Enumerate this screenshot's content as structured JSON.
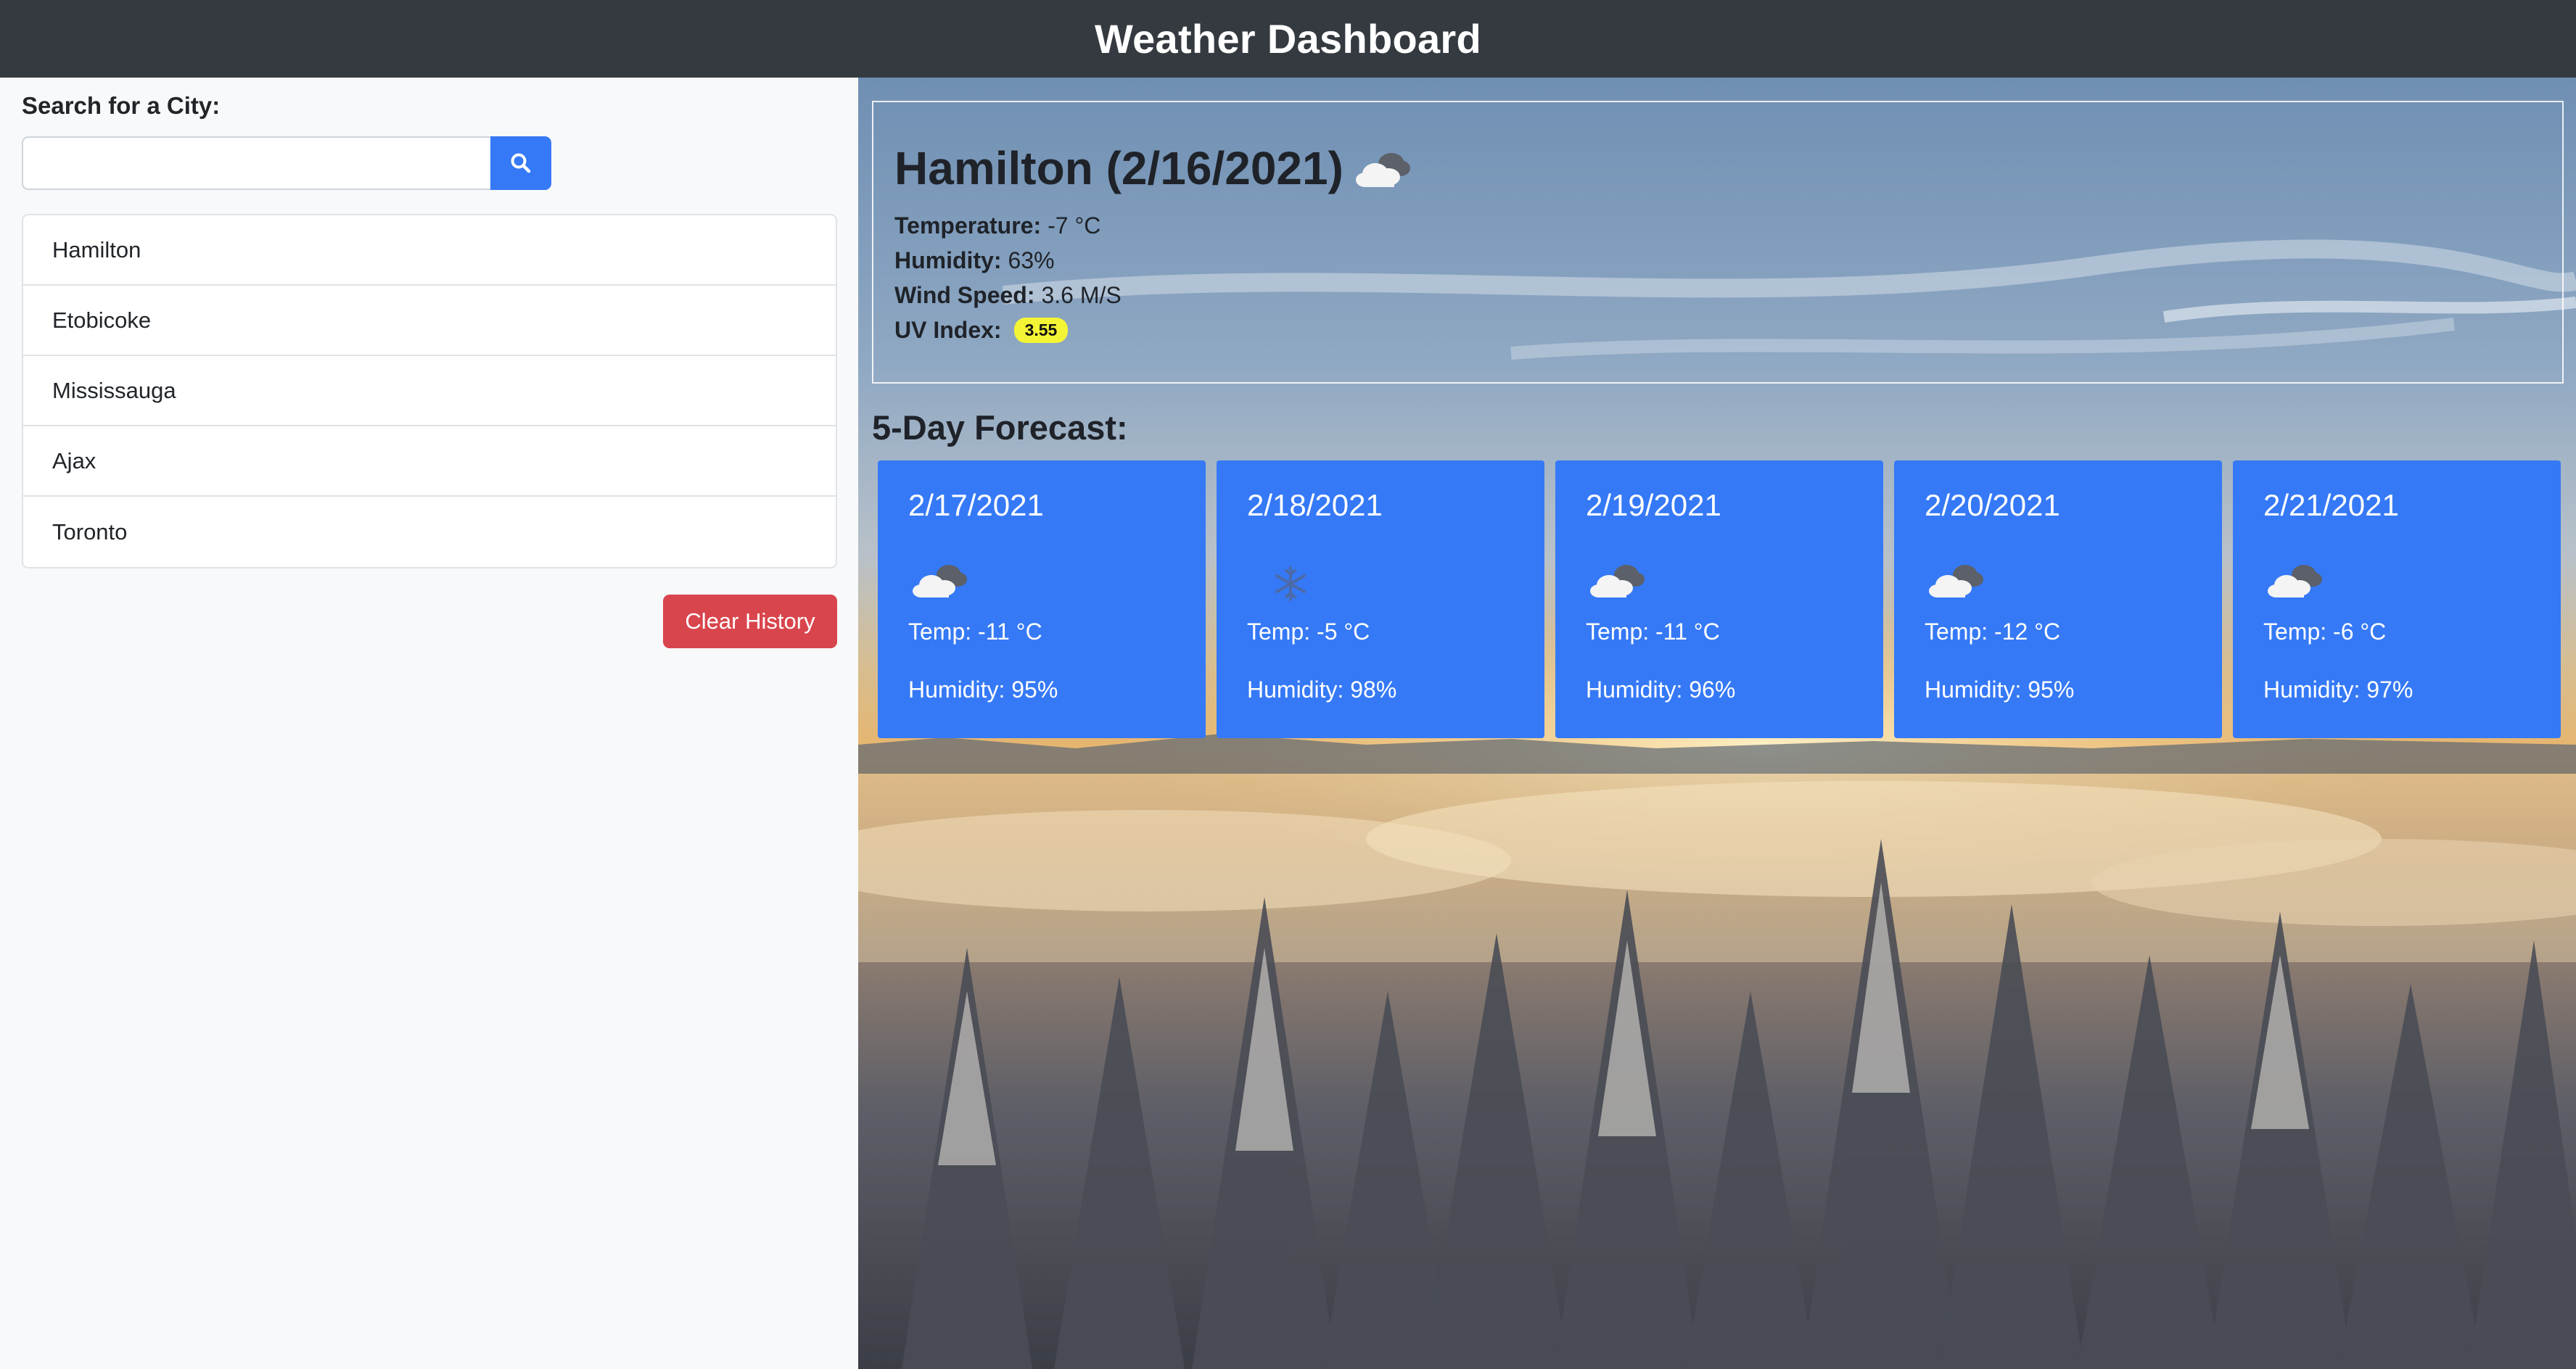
{
  "header": {
    "title": "Weather Dashboard"
  },
  "sidebar": {
    "search_label": "Search for a City:",
    "search_value": "",
    "search_icon": "magnifier-icon",
    "history": [
      "Hamilton",
      "Etobicoke",
      "Mississauga",
      "Ajax",
      "Toronto"
    ],
    "clear_label": "Clear History"
  },
  "current": {
    "heading": "Hamilton (2/16/2021)",
    "icon": "cloud-icon",
    "temperature_label": "Temperature:",
    "temperature_value": "-7 °C",
    "humidity_label": "Humidity:",
    "humidity_value": "63%",
    "wind_label": "Wind Speed:",
    "wind_value": "3.6 M/S",
    "uv_label": "UV Index:",
    "uv_value": "3.55"
  },
  "forecast": {
    "title": "5-Day Forecast:",
    "cards": [
      {
        "date": "2/17/2021",
        "icon": "cloud-icon",
        "temp": "Temp: -11 °C",
        "humidity": "Humidity: 95%"
      },
      {
        "date": "2/18/2021",
        "icon": "snowflake-icon",
        "temp": "Temp: -5 °C",
        "humidity": "Humidity: 98%"
      },
      {
        "date": "2/19/2021",
        "icon": "cloud-icon",
        "temp": "Temp: -11 °C",
        "humidity": "Humidity: 96%"
      },
      {
        "date": "2/20/2021",
        "icon": "cloud-icon",
        "temp": "Temp: -12 °C",
        "humidity": "Humidity: 95%"
      },
      {
        "date": "2/21/2021",
        "icon": "cloud-icon",
        "temp": "Temp: -6 °C",
        "humidity": "Humidity: 97%"
      }
    ]
  },
  "colors": {
    "navbar": "#343a40",
    "primary": "#3579f6",
    "danger": "#d9454c",
    "uv_badge": "#f4f436",
    "sidebar_bg": "#f8f9fa"
  }
}
